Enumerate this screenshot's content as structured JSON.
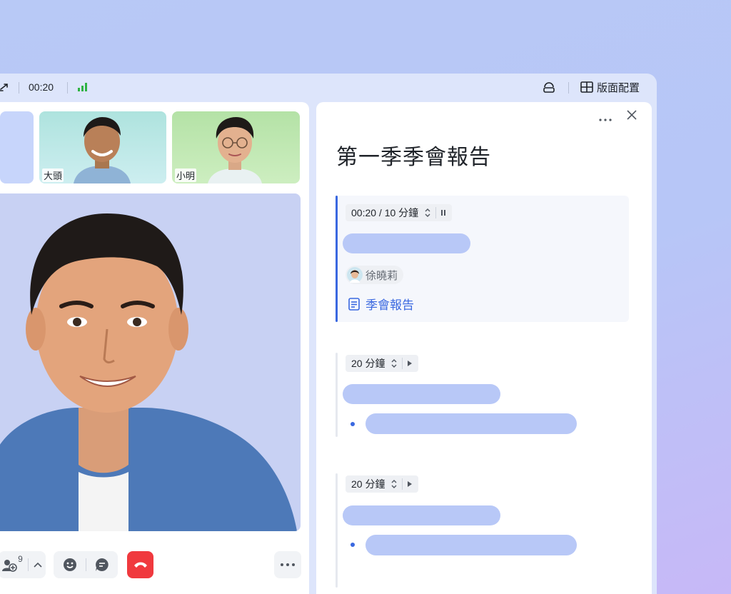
{
  "topbar": {
    "timer": "00:20",
    "layout_label": "版面配置"
  },
  "participants": [
    {
      "name": "大頭"
    },
    {
      "name": "小明"
    }
  ],
  "controls": {
    "participant_count": "9"
  },
  "panel": {
    "title": "第一季季會報告",
    "agenda": [
      {
        "time_label": "00:20 / 10 分鐘",
        "active": true,
        "owner": "徐曉莉",
        "doc_link": "季會報告"
      },
      {
        "time_label": "20 分鐘",
        "active": false
      },
      {
        "time_label": "20 分鐘",
        "active": false
      }
    ]
  },
  "colors": {
    "accent": "#3a68e0",
    "end_call": "#f0393e",
    "signal": "#2fb344",
    "placeholder": "#b8c8f7"
  }
}
